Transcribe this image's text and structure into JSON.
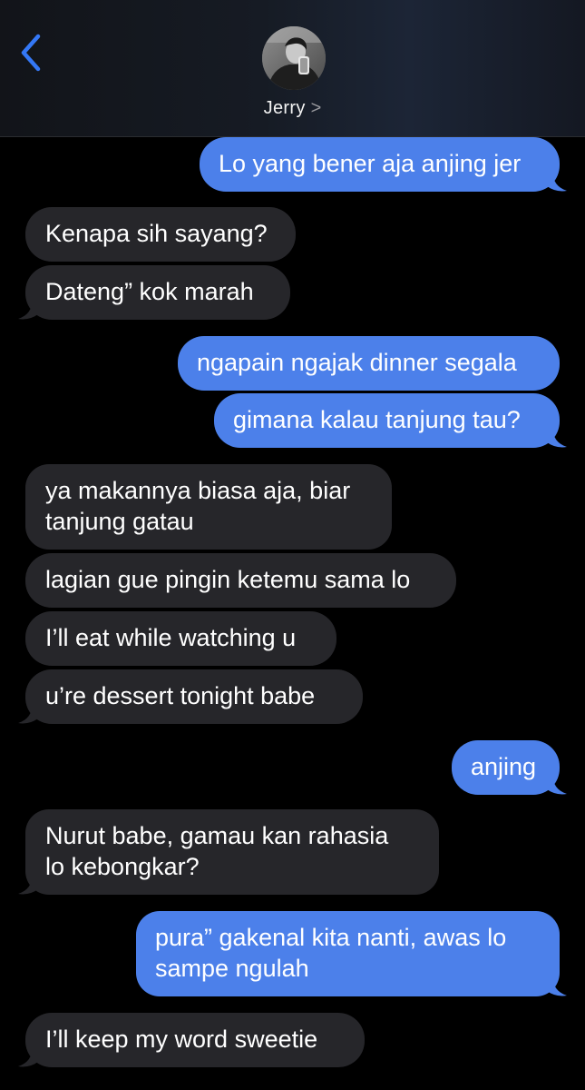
{
  "header": {
    "contact_name": "Jerry",
    "back_icon": "chevron-left-icon",
    "chevron_icon": ">",
    "accent_color": "#3478f6"
  },
  "colors": {
    "outgoing_bubble": "#4c80ea",
    "incoming_bubble": "#26262a",
    "background": "#000000"
  },
  "messages": [
    {
      "dir": "out",
      "lines": [
        "Lo yang bener aja anjing jer"
      ]
    },
    {
      "dir": "in",
      "lines": [
        "Kenapa sih sayang?"
      ]
    },
    {
      "dir": "in",
      "lines": [
        "Dateng” kok marah"
      ]
    },
    {
      "dir": "out",
      "lines": [
        "ngapain ngajak dinner segala"
      ]
    },
    {
      "dir": "out",
      "lines": [
        "gimana kalau tanjung tau?"
      ]
    },
    {
      "dir": "in",
      "lines": [
        "ya makannya biasa aja, biar",
        "tanjung gatau"
      ]
    },
    {
      "dir": "in",
      "lines": [
        "lagian gue pingin ketemu sama lo"
      ]
    },
    {
      "dir": "in",
      "lines": [
        "I’ll eat while watching u"
      ]
    },
    {
      "dir": "in",
      "lines": [
        "u’re dessert tonight babe"
      ]
    },
    {
      "dir": "out",
      "lines": [
        "anjing"
      ]
    },
    {
      "dir": "in",
      "lines": [
        "Nurut babe, gamau kan rahasia",
        "lo kebongkar?"
      ]
    },
    {
      "dir": "out",
      "lines": [
        "pura” gakenal kita nanti, awas lo",
        "sampe ngulah"
      ]
    },
    {
      "dir": "in",
      "lines": [
        "I’ll keep my word sweetie"
      ]
    }
  ]
}
